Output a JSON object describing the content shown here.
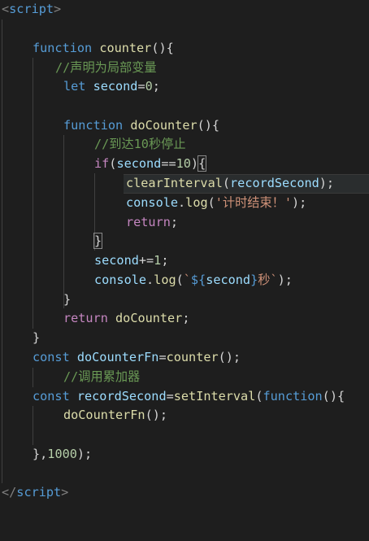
{
  "editor": {
    "theme_colors": {
      "background": "#1e1e1e",
      "keyword": "#569cd6",
      "control": "#c586c0",
      "function": "#dcdcaa",
      "variable": "#9cdcfe",
      "number": "#b5cea8",
      "string": "#ce9178",
      "comment": "#6a9955"
    },
    "lines": {
      "l1": {
        "lt": "<",
        "tag": "script",
        "gt": ">"
      },
      "l3": {
        "kw": "function",
        "name": "counter",
        "rest": "(){"
      },
      "l4": {
        "comment": "//声明为局部变量"
      },
      "l5": {
        "kw": "let",
        "var": "second",
        "eq": "=",
        "num": "0",
        "end": ";"
      },
      "l7": {
        "kw": "function",
        "name": "doCounter",
        "rest": "(){"
      },
      "l8": {
        "comment": "//到达10秒停止"
      },
      "l9": {
        "kw": "if",
        "open": "(",
        "var": "second",
        "op": "==",
        "num": "10",
        "close": ")",
        "brace": "{"
      },
      "l10": {
        "fn": "clearInterval",
        "open": "(",
        "var": "recordSecond",
        "close": ");"
      },
      "l11": {
        "obj": "console",
        "dot": ".",
        "fn": "log",
        "open": "(",
        "str": "'计时结束！'",
        "close": ");"
      },
      "l12": {
        "kw": "return",
        "end": ";"
      },
      "l13": {
        "brace": "}"
      },
      "l14": {
        "var": "second",
        "op": "+=",
        "num": "1",
        "end": ";"
      },
      "l15": {
        "obj": "console",
        "dot": ".",
        "fn": "log",
        "open": "(",
        "tick_open": "`",
        "tpl_open": "${",
        "var": "second",
        "tpl_close": "}",
        "tpl_text": "秒`",
        "close": ");"
      },
      "l16": {
        "brace": "}"
      },
      "l17": {
        "kw": "return",
        "name": "doCounter",
        "end": ";"
      },
      "l18": {
        "brace": "}"
      },
      "l19": {
        "kw": "const",
        "name": "doCounterFn",
        "eq": "=",
        "fn": "counter",
        "rest": "();"
      },
      "l20": {
        "comment": "//调用累加器"
      },
      "l21": {
        "kw": "const",
        "name": "recordSecond",
        "eq": "=",
        "fn": "setInterval",
        "open": "(",
        "kw2": "function",
        "rest": "(){"
      },
      "l22": {
        "fn": "doCounterFn",
        "rest": "();"
      },
      "l24": {
        "open": "},",
        "num": "1000",
        "close": ");"
      },
      "l25": {
        "lt": "</",
        "tag": "script",
        "gt": ">"
      }
    }
  }
}
